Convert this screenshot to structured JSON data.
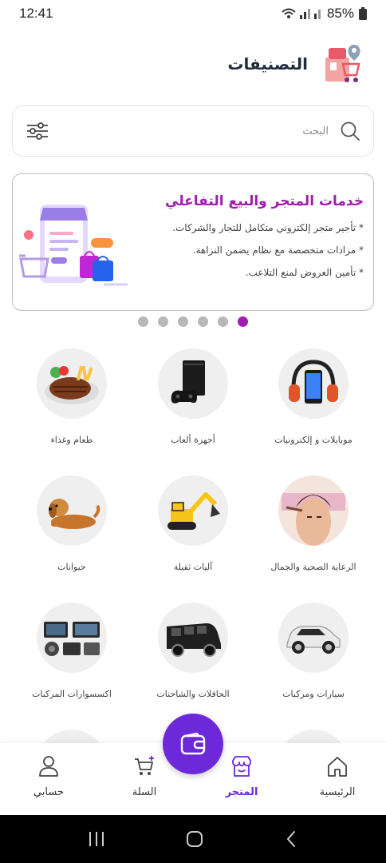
{
  "status_bar": {
    "time": "12:41",
    "battery": "85%"
  },
  "header": {
    "title": "التصنيفات"
  },
  "search": {
    "placeholder": "البحث"
  },
  "banner": {
    "title": "خدمات المتجر والبيع التفاعلي",
    "lines": [
      "* تأجير متجر إلكتروني متكامل للتجار والشركات.",
      "* مزادات متخصصة مع نظام يضمن النزاهة.",
      "* تأمين العروض لمنع التلاعب."
    ],
    "dot_count": 6,
    "active_dot": 6
  },
  "categories": [
    {
      "label": "موبايلات و إلكترونيات",
      "icon": "headphones-phone-icon"
    },
    {
      "label": "أجهزة ألعاب",
      "icon": "game-console-icon"
    },
    {
      "label": "طعام وغذاء",
      "icon": "steak-food-icon"
    },
    {
      "label": "الرعاية الصحية والجمال",
      "icon": "face-care-icon"
    },
    {
      "label": "آليات ثقيلة",
      "icon": "excavator-icon"
    },
    {
      "label": "حيوانات",
      "icon": "dog-icon"
    },
    {
      "label": "سيارات ومركبات",
      "icon": "car-icon"
    },
    {
      "label": "الحافلات والشاحنات",
      "icon": "van-icon"
    },
    {
      "label": "اكسسوارات المركبات",
      "icon": "car-electronics-icon"
    }
  ],
  "bottom_nav": {
    "home": "الرئيسية",
    "store": "المتجر",
    "cart": "السلة",
    "account": "حسابي",
    "active": "store"
  },
  "colors": {
    "accent": "#6d28d9",
    "banner_title": "#a21caf"
  }
}
